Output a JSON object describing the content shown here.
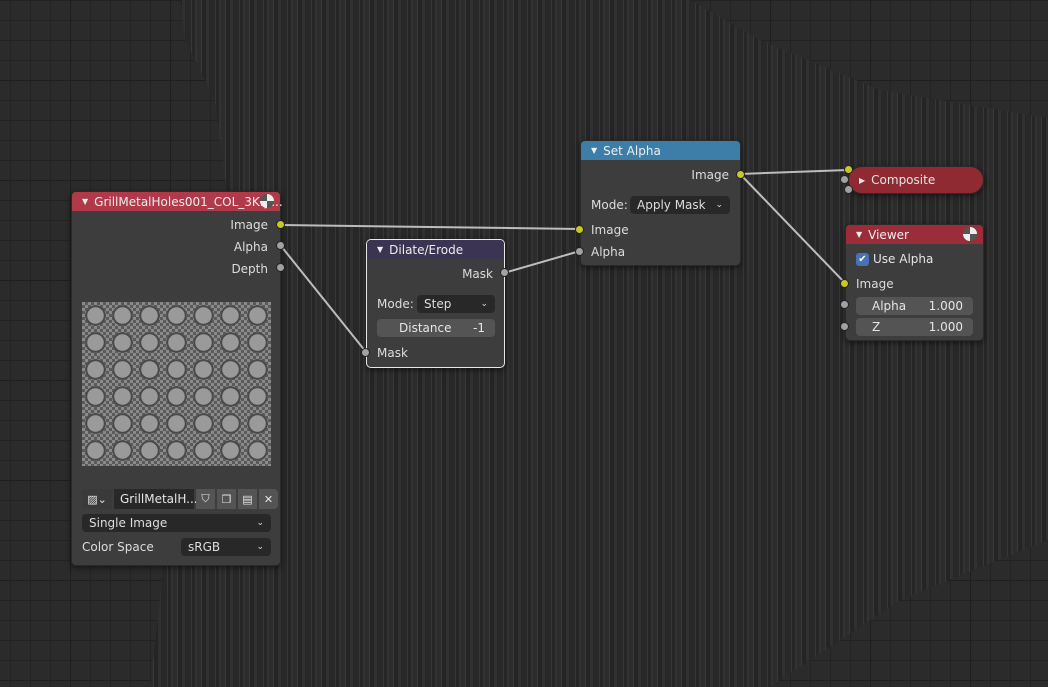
{
  "image_node": {
    "title": "GrillMetalHoles001_COL_3K.p...",
    "outputs": [
      "Image",
      "Alpha",
      "Depth"
    ],
    "image_name": "GrillMetalH...",
    "source": "Single Image",
    "color_space_label": "Color Space",
    "color_space": "sRGB",
    "header_color": "#b0394a"
  },
  "dilate_node": {
    "title": "Dilate/Erode",
    "output": "Mask",
    "mode_label": "Mode:",
    "mode": "Step",
    "distance_label": "Distance",
    "distance": "-1",
    "input": "Mask",
    "header_color": "#3b3452"
  },
  "set_alpha_node": {
    "title": "Set Alpha",
    "output": "Image",
    "mode_label": "Mode:",
    "mode": "Apply Mask",
    "inputs": [
      "Image",
      "Alpha"
    ],
    "header_color": "#3c7ea7"
  },
  "composite_node": {
    "title": "Composite",
    "header_color": "#8f2a33"
  },
  "viewer_node": {
    "title": "Viewer",
    "use_alpha_label": "Use Alpha",
    "use_alpha": true,
    "input": "Image",
    "alpha_label": "Alpha",
    "alpha": "1.000",
    "z_label": "Z",
    "z": "1.000",
    "header_color": "#9a2d39"
  }
}
